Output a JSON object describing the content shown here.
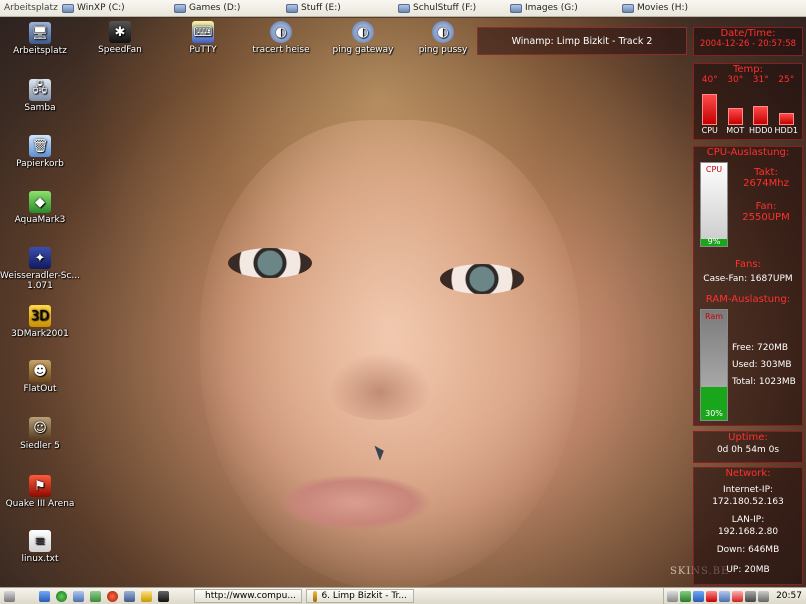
{
  "topbar": {
    "first": "Arbeitsplatz",
    "drives": [
      "WinXP (C:)",
      "Games (D:)",
      "Stuff (E:)",
      "SchulStuff (F:)",
      "Images (G:)",
      "Movies (H:)"
    ]
  },
  "desktop_icons_left": [
    "Arbeitsplatz",
    "Samba",
    "Papierkorb",
    "AquaMark3",
    "Weisseradler-Sc... 1.071",
    "3DMark2001",
    "FlatOut",
    "Siedler 5",
    "Quake III Arena",
    "linux.txt"
  ],
  "desktop_icons_top": [
    "SpeedFan",
    "PuTTY",
    "tracert heise",
    "ping gateway",
    "ping pussy"
  ],
  "winamp": {
    "text": "Winamp: Limp Bizkit - Track  2"
  },
  "datetime": {
    "title": "Date/Time:",
    "value": "2004-12-26 - 20:57:58"
  },
  "temp": {
    "title": "Temp:",
    "sensors": [
      {
        "label": "CPU",
        "value": "40°",
        "level": 0.9
      },
      {
        "label": "MOT",
        "value": "30°",
        "level": 0.5
      },
      {
        "label": "HDD0",
        "value": "31°",
        "level": 0.55
      },
      {
        "label": "HDD1",
        "value": "25°",
        "level": 0.35
      }
    ]
  },
  "cpu": {
    "title": "CPU-Auslastung:",
    "bar_label": "CPU",
    "percent_text": "9%",
    "percent": 0.09,
    "takt_label": "Takt:",
    "takt_value": "2674Mhz",
    "fan_label": "Fan:",
    "fan_value": "2550UPM"
  },
  "fans": {
    "title": "Fans:",
    "case_fan": "Case-Fan: 1687UPM"
  },
  "ram": {
    "title": "RAM-Auslastung:",
    "bar_label": "Ram",
    "percent_text": "30%",
    "percent": 0.3,
    "free": "Free: 720MB",
    "used": "Used: 303MB",
    "total": "Total: 1023MB"
  },
  "uptime": {
    "title": "Uptime:",
    "value": "0d 0h 54m 0s"
  },
  "network": {
    "title": "Network:",
    "internet_label": "Internet-IP:",
    "internet_ip": "172.180.52.163",
    "lan_label": "LAN-IP:",
    "lan_ip": "192.168.2.80",
    "down": "Down: 646MB",
    "up": "UP: 20MB"
  },
  "watermark": "SKINS.BE",
  "taskbar": {
    "tasks": [
      "http://www.compu...",
      "6. Limp Bizkit - Tr..."
    ],
    "clock": "20:57"
  }
}
